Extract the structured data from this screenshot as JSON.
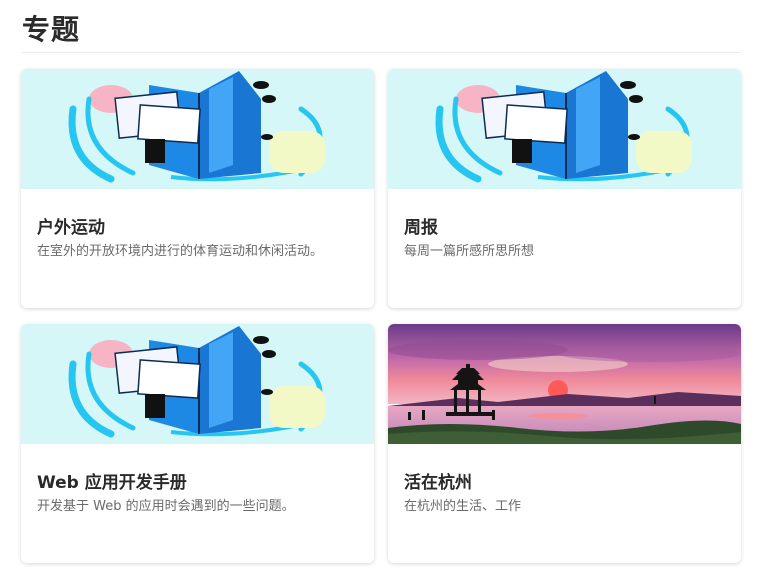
{
  "page": {
    "title": "专题"
  },
  "topics": [
    {
      "title": "户外运动",
      "description": "在室外的开放环境内进行的体育运动和休闲活动。",
      "cover_icon": "book-illustration"
    },
    {
      "title": "周报",
      "description": "每周一篇所感所思所想",
      "cover_icon": "book-illustration"
    },
    {
      "title": "Web 应用开发手册",
      "description": "开发基于 Web 的应用时会遇到的一些问题。",
      "cover_icon": "book-illustration"
    },
    {
      "title": "活在杭州",
      "description": "在杭州的生活、工作",
      "cover_icon": "west-lake-sunset-photo"
    }
  ],
  "colors": {
    "cover_bg": "#d5f7f7",
    "book_blue": "#1e88e5",
    "accent_cyan": "#26c6f1",
    "sunset_pink": "#e86a8c"
  }
}
